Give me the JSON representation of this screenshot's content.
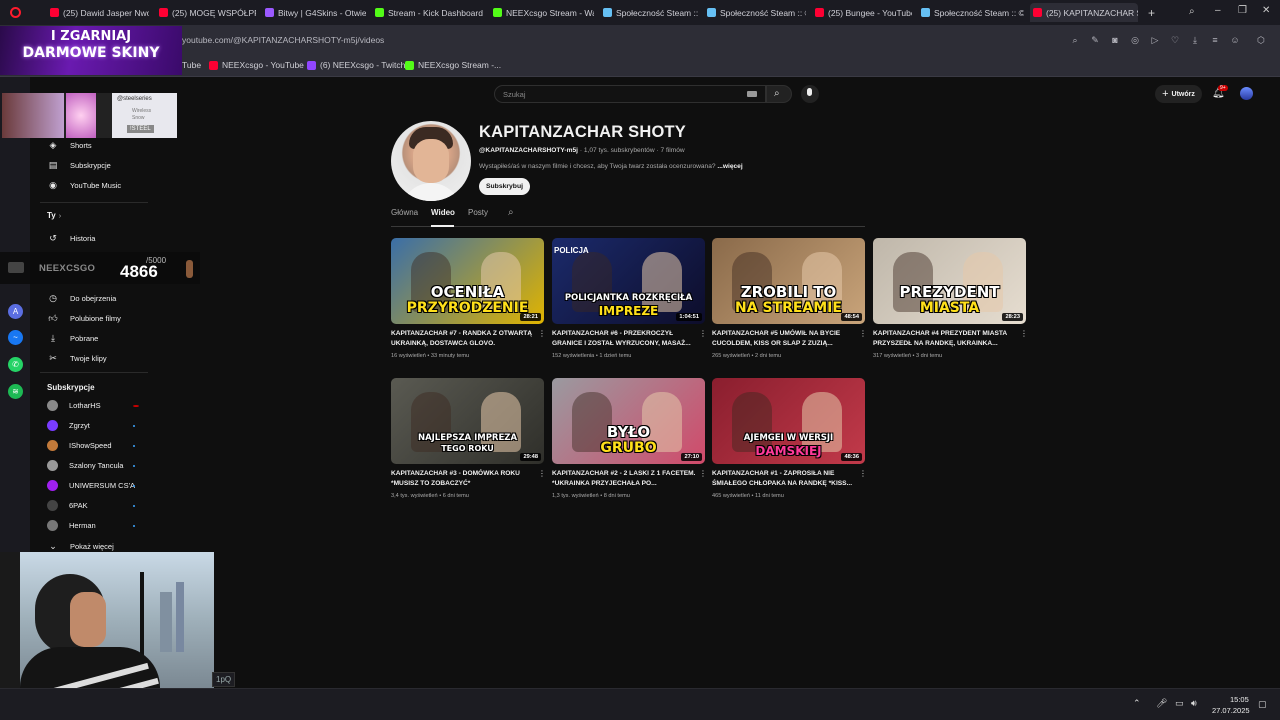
{
  "browser": {
    "tabs": [
      {
        "label": "(25) Dawid Jasper Nword",
        "color": "#ff0033"
      },
      {
        "label": "(25) MOGĘ WSPÓŁPRAC",
        "color": "#ff0033"
      },
      {
        "label": "Bitwy | G4Skins - Otwier",
        "color": "#9b59ff"
      },
      {
        "label": "Stream - Kick Dashboard",
        "color": "#53fc18"
      },
      {
        "label": "NEEXcsgo Stream - Watc",
        "color": "#53fc18"
      },
      {
        "label": "Społeczność Steam :: ©R",
        "color": "#66c0f4"
      },
      {
        "label": "Społeczność Steam :: ©R",
        "color": "#66c0f4"
      },
      {
        "label": "(25) Bungee - YouTube",
        "color": "#ff0033"
      },
      {
        "label": "Społeczność Steam :: ©R",
        "color": "#66c0f4"
      },
      {
        "label": "(25) KAPITANZACHAR SH",
        "color": "#ff0033"
      }
    ],
    "url": "youtube.com/@KAPITANZACHARSHOTY-m5j/videos",
    "bookmarks": [
      {
        "label": "Tube",
        "color": "#ff0033"
      },
      {
        "label": "NEEXcsgo - YouTube",
        "color": "#ff0033"
      },
      {
        "label": "(6) NEEXcsgo - Twitch",
        "color": "#9146ff"
      },
      {
        "label": "NEEXcsgo Stream -...",
        "color": "#53fc18"
      }
    ]
  },
  "overlay": {
    "promo_line1": "I ZGARNIAJ",
    "promo_line2": "DARMOWE SKINY",
    "steelseries_tag": "@steelseries",
    "steel_label": "!STEEL",
    "ad_line": "Wireless",
    "ad_line2": "Snow",
    "neex_brand": "NEEXCSGO",
    "goal_target": "/5000",
    "goal_current": "4866",
    "tooltip": "1pQ"
  },
  "youtube": {
    "search_placeholder": "Szukaj",
    "create_label": "Utwórz",
    "notif_count": "9+",
    "sidebar": {
      "top_items": [
        {
          "label": "Shorts",
          "icon": "shorts-icon"
        },
        {
          "label": "Subskrypcje",
          "icon": "subscriptions-icon"
        },
        {
          "label": "YouTube Music",
          "icon": "music-icon"
        }
      ],
      "you_label": "Ty",
      "you_items": [
        {
          "label": "Historia",
          "icon": "history-icon"
        },
        {
          "label": "Do obejrzenia",
          "icon": "clock-icon"
        },
        {
          "label": "Polubione filmy",
          "icon": "like-icon"
        },
        {
          "label": "Pobrane",
          "icon": "download-icon"
        },
        {
          "label": "Twoje klipy",
          "icon": "scissors-icon"
        }
      ],
      "subs_label": "Subskrypcje",
      "subs": [
        {
          "label": "LotharHS",
          "color": "#8a8a8a",
          "live": true
        },
        {
          "label": "Zgrzyt",
          "color": "#7a3cff",
          "live": false
        },
        {
          "label": "IShowSpeed",
          "color": "#c27a3a",
          "live": false
        },
        {
          "label": "Szalony Tancula",
          "color": "#999",
          "live": false
        },
        {
          "label": "UNIWERSUM CS'A",
          "color": "#a020f0",
          "live": false
        },
        {
          "label": "6PAK",
          "color": "#444",
          "live": false
        },
        {
          "label": "Herman",
          "color": "#777",
          "live": false
        }
      ],
      "show_more": "Pokaż więcej"
    },
    "channel": {
      "name": "KAPITANZACHAR SHOTY",
      "handle": "@KAPITANZACHARSHOTY-m5j",
      "stats": "· 1,07 tys. subskrybentów · 7 filmów",
      "description": "Wystąpiłeś/aś w naszym filmie i chcesz, aby Twoja twarz została ocenzurowana?",
      "more": " ...więcej",
      "subscribe": "Subskrybuj",
      "tabs": [
        "Główna",
        "Wideo",
        "Posty"
      ]
    },
    "videos": [
      {
        "title": "KAPITANZACHAR #7 - RANDKA Z OTWARTĄ UKRAINKĄ, DOSTAWCA GLOVO.",
        "views": "16 wyświetleń",
        "age": "33 minuty temu",
        "duration": "28:21",
        "caption1": "OCENIŁA",
        "caption2": "PRZYRODZENIE",
        "bg": "#3a6ea8",
        "bg2": "#e0b400",
        "c1": "#ffffff",
        "c2": "#ffe01a"
      },
      {
        "title": "KAPITANZACHAR #6 - PRZEKROCZYŁ GRANICE I ZOSTAŁ WYRZUCONY, MASAŻ...",
        "views": "152 wyświetlenia",
        "age": "1 dzień temu",
        "duration": "1:04:51",
        "caption1": "POLICJANTKA ROZKRĘCIŁA",
        "caption2": "IMPREZE",
        "bg": "#1b2a6b",
        "bg2": "#0d0d2a",
        "c1": "#ffffff",
        "c2": "#ffe01a",
        "badge": "POLICJA"
      },
      {
        "title": "KAPITANZACHAR #5 UMÓWIŁ NA BYCIE CUCOLDEM, KISS OR SLAP Z ZUZIĄ...",
        "views": "265 wyświetleń",
        "age": "2 dni temu",
        "duration": "48:54",
        "caption1": "ZROBILI TO",
        "caption2": "NA STREAMIE",
        "bg": "#8a6a4a",
        "bg2": "#c9a47a",
        "c1": "#ffffff",
        "c2": "#ffe01a"
      },
      {
        "title": "KAPITANZACHAR #4 PREZYDENT MIASTA PRZYSZEDŁ NA RANDKĘ, UKRAINKA...",
        "views": "317 wyświetleń",
        "age": "3 dni temu",
        "duration": "28:23",
        "caption1": "PREZYDENT",
        "caption2": "MIASTA",
        "bg": "#bfb7aa",
        "bg2": "#e6ddd0",
        "c1": "#ffffff",
        "c2": "#ffe01a"
      },
      {
        "title": "KAPITANZACHAR #3 - DOMÓWKA ROKU *MUSISZ TO ZOBACZYĆ*",
        "views": "3,4 tys. wyświetleń",
        "age": "6 dni temu",
        "duration": "29:48",
        "caption1": "NAJLEPSZA IMPREZA",
        "caption2": "TEGO ROKU",
        "bg": "#5a5a52",
        "bg2": "#2f2f2a",
        "c1": "#ffffff",
        "c2": "#ffffff"
      },
      {
        "title": "KAPITANZACHAR #2 - 2 LASKI Z 1 FACETEM. *UKRAINKA PRZYJECHAŁA PO...",
        "views": "1,3 tys. wyświetleń",
        "age": "8 dni temu",
        "duration": "27:10",
        "caption1": "BYŁO",
        "caption2": "GRUBO",
        "bg": "#9a9aa0",
        "bg2": "#d14a6a",
        "c1": "#ffffff",
        "c2": "#ffe01a"
      },
      {
        "title": "KAPITANZACHAR #1 - ZAPROSIŁA NIE ŚMIAŁEGO CHŁOPAKA NA RANDKĘ *KISS...",
        "views": "465 wyświetleń",
        "age": "11 dni temu",
        "duration": "48:36",
        "caption1": "AJEMGEI W WERSJI",
        "caption2": "DAMSKIEJ",
        "bg": "#8a1e2e",
        "bg2": "#c23a4a",
        "c1": "#ffffff",
        "c2": "#ff3a9a"
      }
    ]
  },
  "taskbar": {
    "time": "15:05",
    "date": "27.07.2025"
  }
}
